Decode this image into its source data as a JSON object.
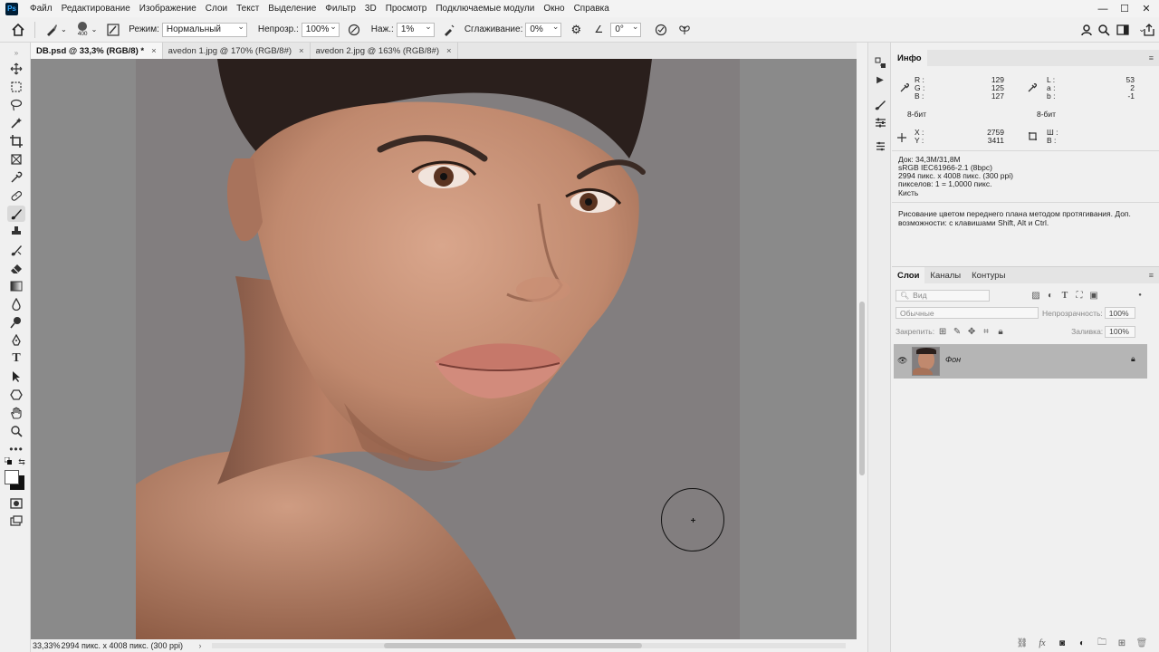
{
  "menubar": {
    "logo": "Ps",
    "items": [
      "Файл",
      "Редактирование",
      "Изображение",
      "Слои",
      "Текст",
      "Выделение",
      "Фильтр",
      "3D",
      "Просмотр",
      "Подключаемые модули",
      "Окно",
      "Справка"
    ],
    "minimize": "—",
    "maximize": "☐",
    "close": "✕"
  },
  "options": {
    "brush_size": "400",
    "mode_label": "Режим:",
    "mode_value": "Нормальный",
    "opacity_label": "Непрозр.:",
    "opacity_value": "100%",
    "pressure_label": "Наж.:",
    "pressure_value": "1%",
    "smoothing_label": "Сглаживание:",
    "smoothing_value": "0%",
    "angle_value": "0°"
  },
  "tabs": [
    {
      "label": "DB.psd @ 33,3% (RGB/8) *",
      "close": "×"
    },
    {
      "label": "avedon 1.jpg @ 170% (RGB/8#)",
      "close": "×"
    },
    {
      "label": "avedon 2.jpg @ 163% (RGB/8#)",
      "close": "×"
    }
  ],
  "statusbar": {
    "zoom": "33,33%",
    "doc_info": "2994 пикс. x 4008 пикс. (300 ppi)"
  },
  "info": {
    "tab": "Инфо",
    "r_label": "R :",
    "g_label": "G :",
    "b_label": "B :",
    "r": "129",
    "g": "125",
    "b": "127",
    "l_label": "L :",
    "a_label": "a :",
    "b2_label": "b :",
    "l": "53",
    "a": "2",
    "b2": "-1",
    "bit_left": "8-бит",
    "bit_right": "8-бит",
    "x_label": "X :",
    "y_label": "Y :",
    "x": "2759",
    "y": "3411",
    "w_label": "Ш :",
    "h_label": "В :",
    "doc_size": "Док: 34,3M/31,8M",
    "profile": "sRGB IEC61966-2.1 (8bpc)",
    "dimensions": "2994 пикс. x 4008 пикс. (300 ppi)",
    "pixels": "пикселов: 1 = 1,0000 пикс.",
    "tool": "Кисть",
    "hint": "Рисование цветом переднего плана методом протягивания. Доп. возможности: с клавишами Shift, Alt и Ctrl."
  },
  "layers": {
    "tabs": [
      "Слои",
      "Каналы",
      "Контуры"
    ],
    "search_placeholder": "Вид",
    "blend_mode": "Обычные",
    "opacity_label": "Непрозрачность:",
    "opacity_value": "100%",
    "lock_label": "Закрепить:",
    "fill_label": "Заливка:",
    "fill_value": "100%",
    "layer_name": "Фон"
  },
  "colors": {
    "accent": "#31a8ff",
    "canvas_bg": "#8a8a8a",
    "photo_bg": "#827e7f",
    "skin": "#c0896e"
  }
}
